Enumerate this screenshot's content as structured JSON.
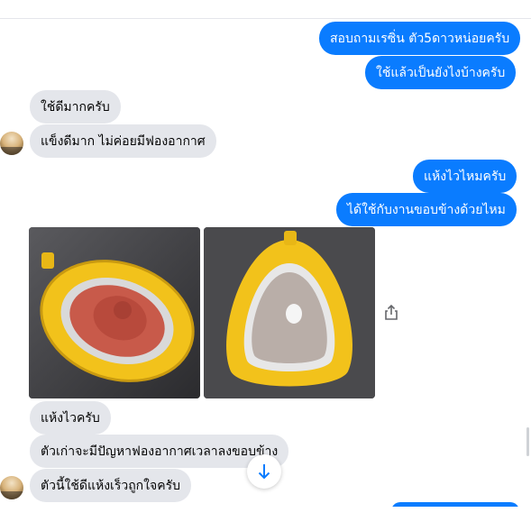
{
  "messages": {
    "out_1": "สอบถามเรซิ่น ตัว5ดาวหน่อยครับ",
    "out_2": "ใช้แล้วเป็นยังไงบ้างครับ",
    "in_1": "ใช้ดีมากครับ",
    "in_2": "แข็งดีมาก ไม่ค่อยมีฟองอากาศ",
    "out_3": "แห้งไวไหมครับ",
    "out_4": "ได้ใช้กับงานขอบข้างด้วยไหม",
    "in_3": "แห้งไวครับ",
    "in_4": "ตัวเก่าจะมีปัญหาฟองอากาศเวลาลงขอบข้าง",
    "in_5": "ตัวนี้ใช้ดีแห้งเร็วถูกใจครับ"
  },
  "colors": {
    "outgoing_bubble": "#0a7cff",
    "incoming_bubble": "#e4e6eb",
    "pendant_frame": "#f2c21b"
  },
  "icons": {
    "share": "share-icon",
    "scroll_down": "arrow-down-icon"
  }
}
